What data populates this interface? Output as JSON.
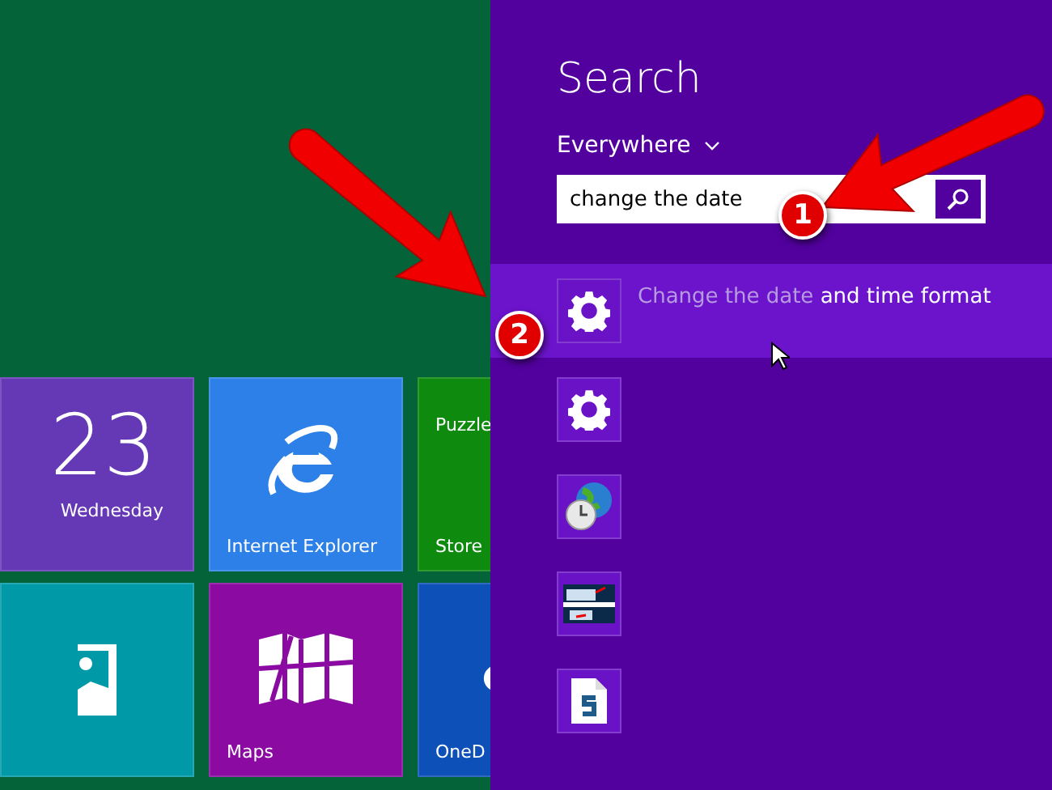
{
  "start_screen": {
    "tiles": [
      {
        "kind": "calendar",
        "number": "23",
        "label": "Wednesday",
        "color": "#6538b6"
      },
      {
        "kind": "browser",
        "label": "Internet Explorer",
        "color": "#2d80e8"
      },
      {
        "kind": "store",
        "subtitle": "Puzzle",
        "label": "Store",
        "color": "#0e8a0e"
      },
      {
        "kind": "photos",
        "color": "#0099a8"
      },
      {
        "kind": "maps",
        "label": "Maps",
        "color": "#8a0aa2"
      },
      {
        "kind": "cloud",
        "label": "OneD",
        "color": "#0c50b8"
      }
    ]
  },
  "search_pane": {
    "title": "Search",
    "scope": "Everywhere",
    "query": "change the date",
    "results": [
      {
        "kind": "gear",
        "match": "Change the date",
        "text": " and time format",
        "selected": true
      },
      {
        "kind": "gear",
        "selected": false
      },
      {
        "kind": "globe-clock",
        "selected": false
      },
      {
        "kind": "screenshot",
        "selected": false
      },
      {
        "kind": "document",
        "selected": false
      }
    ]
  },
  "annotations": [
    {
      "number": "1"
    },
    {
      "number": "2"
    }
  ]
}
